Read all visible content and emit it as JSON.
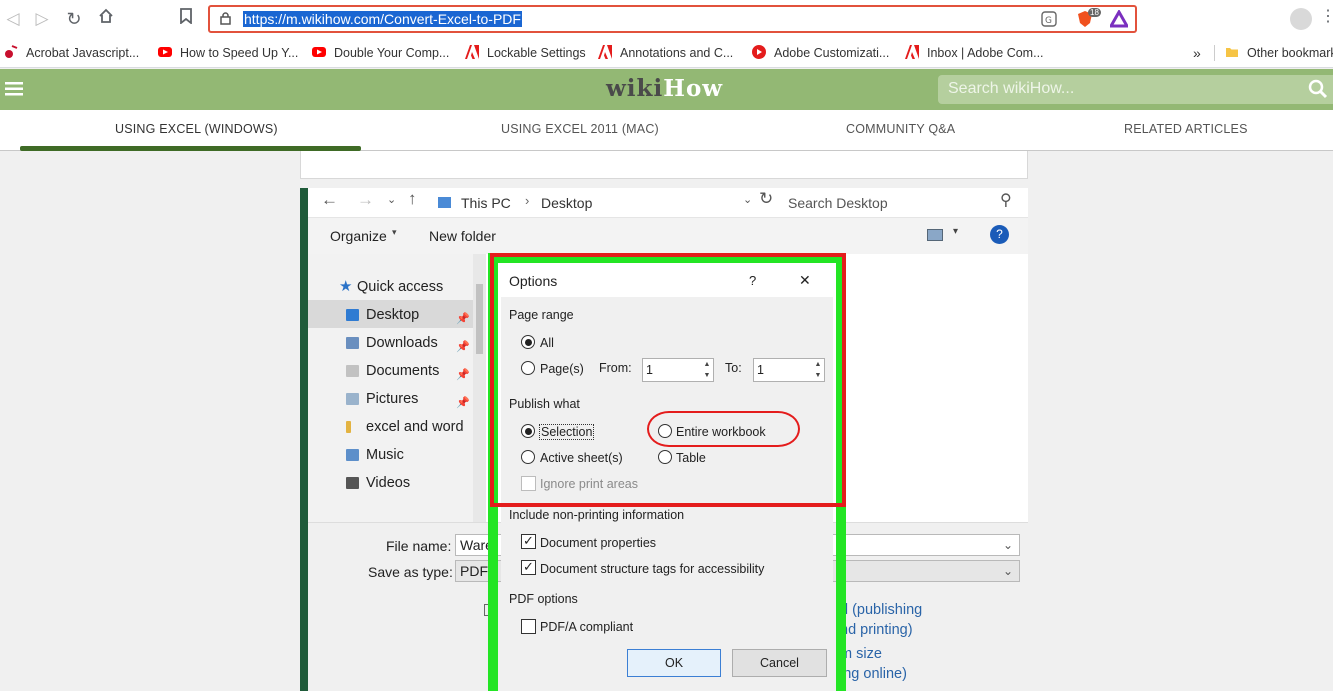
{
  "browser": {
    "url": "https://m.wikihow.com/Convert-Excel-to-PDF",
    "bookmarks": [
      {
        "label": "Acrobat Javascript...",
        "icon": "acrobat-icon"
      },
      {
        "label": "How to Speed Up Y...",
        "icon": "youtube-icon"
      },
      {
        "label": "Double Your Comp...",
        "icon": "youtube-icon"
      },
      {
        "label": "Lockable Settings",
        "icon": "adobe-icon"
      },
      {
        "label": "Annotations and C...",
        "icon": "adobe-icon"
      },
      {
        "label": "Adobe Customizati...",
        "icon": "adobe-media-icon"
      },
      {
        "label": "Inbox | Adobe Com...",
        "icon": "adobe-icon"
      }
    ],
    "more": "»",
    "other_bookmarks": "Other bookmarks",
    "extension_badge": "18"
  },
  "site": {
    "logo_wiki": "wiki",
    "logo_how": "How",
    "search_placeholder": "Search wikiHow...",
    "tabs": [
      "USING EXCEL (WINDOWS)",
      "USING EXCEL 2011 (MAC)",
      "COMMUNITY Q&A",
      "RELATED ARTICLES"
    ]
  },
  "save_dialog": {
    "path": [
      "This PC",
      "Desktop"
    ],
    "search_placeholder": "Search Desktop",
    "organize": "Organize",
    "new_folder": "New folder",
    "nav_items": [
      "Quick access",
      "Desktop",
      "Downloads",
      "Documents",
      "Pictures",
      "excel and word",
      "Music",
      "Videos"
    ],
    "file_name_label": "File name:",
    "file_name_value": "Ware",
    "save_type_label": "Save as type:",
    "save_type_value": "PDF (",
    "link1a": "d (publishing",
    "link1b": "nd printing)",
    "link2a": "m size",
    "link2b": "ing online)"
  },
  "options": {
    "title": "Options",
    "help": "?",
    "close": "✕",
    "page_range": "Page range",
    "all": "All",
    "pages": "Page(s)",
    "from_label": "From:",
    "from_value": "1",
    "to_label": "To:",
    "to_value": "1",
    "publish_what": "Publish what",
    "selection": "Selection",
    "entire_workbook": "Entire workbook",
    "active_sheets": "Active sheet(s)",
    "table": "Table",
    "ignore_print_areas": "Ignore print areas",
    "include_nonprinting": "Include non-printing information",
    "doc_properties": "Document properties",
    "doc_structure": "Document structure tags for accessibility",
    "pdf_options": "PDF options",
    "pdfa": "PDF/A compliant",
    "ok": "OK",
    "cancel": "Cancel"
  },
  "colors": {
    "highlight_red": "#e41c1c",
    "highlight_green": "#23e524",
    "wikihow_green": "#93b874"
  }
}
